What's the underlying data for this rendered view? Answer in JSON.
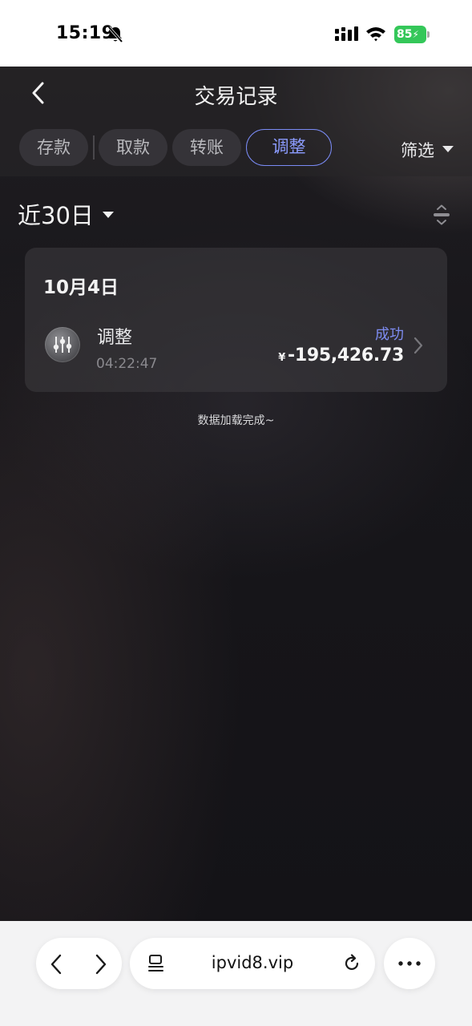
{
  "status_bar": {
    "time": "15:19",
    "battery": "85"
  },
  "header": {
    "title": "交易记录"
  },
  "tabs": [
    {
      "label": "存款",
      "active": false
    },
    {
      "label": "取款",
      "active": false
    },
    {
      "label": "转账",
      "active": false
    },
    {
      "label": "调整",
      "active": true
    }
  ],
  "filter": {
    "label": "筛选"
  },
  "range": {
    "label": "近30日"
  },
  "transactions": {
    "date": "10月4日",
    "items": [
      {
        "type": "调整",
        "time": "04:22:47",
        "status": "成功",
        "currency": "¥",
        "amount": "-195,426.73"
      }
    ]
  },
  "footer_note": "数据加载完成~",
  "browser": {
    "url": "ipvid8.vip"
  },
  "colors": {
    "accent": "#7d8cf0",
    "success_battery": "#34c759",
    "background": "#17161a"
  },
  "icons": [
    "bell-slash-icon",
    "cellular-signal-icon",
    "wifi-icon",
    "back-arrow-icon",
    "caret-down-icon",
    "collapse-expand-icon",
    "sliders-icon",
    "chevron-right-icon",
    "browser-back-icon",
    "browser-forward-icon",
    "reader-icon",
    "reload-icon",
    "more-icon"
  ]
}
